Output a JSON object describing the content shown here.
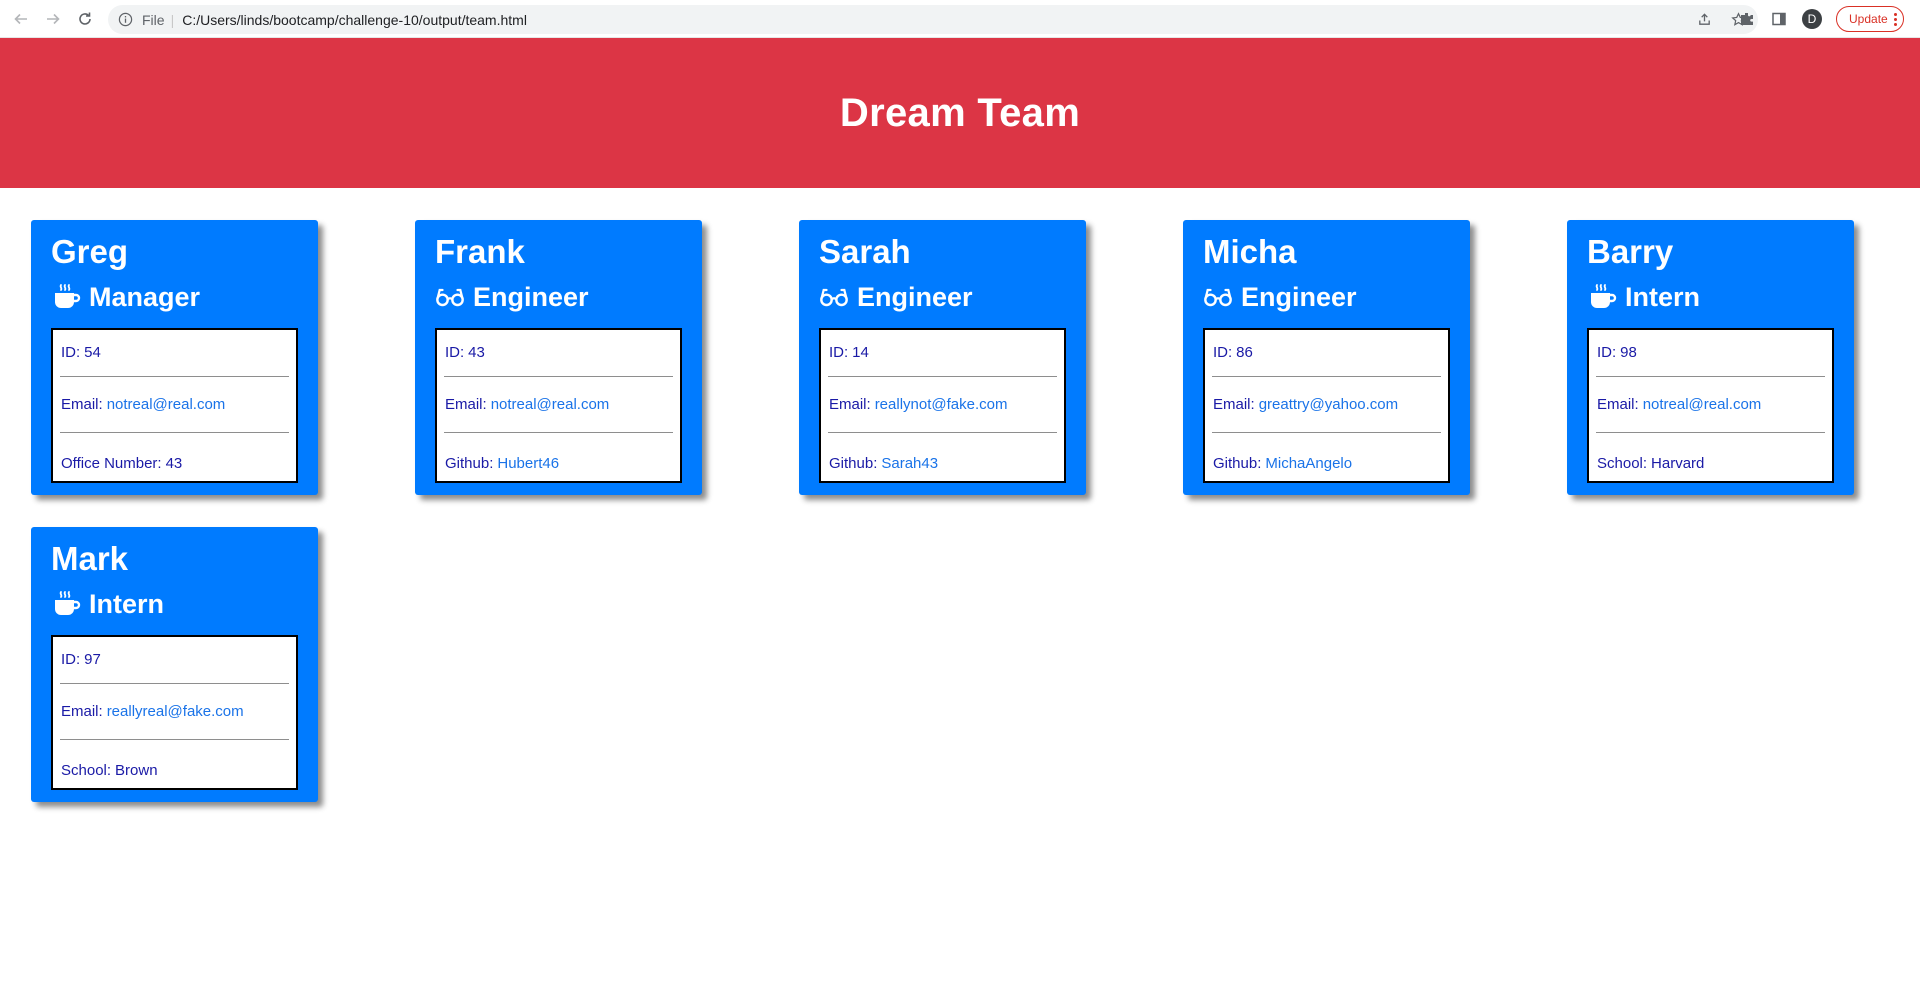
{
  "browser": {
    "scheme": "File",
    "url": "C:/Users/linds/bootcamp/challenge-10/output/team.html",
    "profile_initial": "D",
    "update_label": "Update",
    "colors": {
      "update": "#d93025"
    }
  },
  "header": {
    "title": "Dream Team",
    "color": "#dc3545"
  },
  "card_color": "#007bff",
  "team": [
    {
      "name": "Greg",
      "role": "Manager",
      "icon": "mug-icon",
      "id_label": "ID:",
      "id": "54",
      "email_label": "Email:",
      "email": "notreal@real.com",
      "extra_label": "Office Number:",
      "extra": "43",
      "extra_is_link": false
    },
    {
      "name": "Frank",
      "role": "Engineer",
      "icon": "glasses-icon",
      "id_label": "ID:",
      "id": "43",
      "email_label": "Email:",
      "email": "notreal@real.com",
      "extra_label": "Github:",
      "extra": "Hubert46",
      "extra_is_link": true
    },
    {
      "name": "Sarah",
      "role": "Engineer",
      "icon": "glasses-icon",
      "id_label": "ID:",
      "id": "14",
      "email_label": "Email:",
      "email": "reallynot@fake.com",
      "extra_label": "Github:",
      "extra": "Sarah43",
      "extra_is_link": true
    },
    {
      "name": "Micha",
      "role": "Engineer",
      "icon": "glasses-icon",
      "id_label": "ID:",
      "id": "86",
      "email_label": "Email:",
      "email": "greattry@yahoo.com",
      "extra_label": "Github:",
      "extra": "MichaAngelo",
      "extra_is_link": true
    },
    {
      "name": "Barry",
      "role": "Intern",
      "icon": "mug-icon",
      "id_label": "ID:",
      "id": "98",
      "email_label": "Email:",
      "email": "notreal@real.com",
      "extra_label": "School:",
      "extra": "Harvard",
      "extra_is_link": false
    },
    {
      "name": "Mark",
      "role": "Intern",
      "icon": "mug-icon",
      "id_label": "ID:",
      "id": "97",
      "email_label": "Email:",
      "email": "reallyreal@fake.com",
      "extra_label": "School:",
      "extra": "Brown",
      "extra_is_link": false
    }
  ]
}
